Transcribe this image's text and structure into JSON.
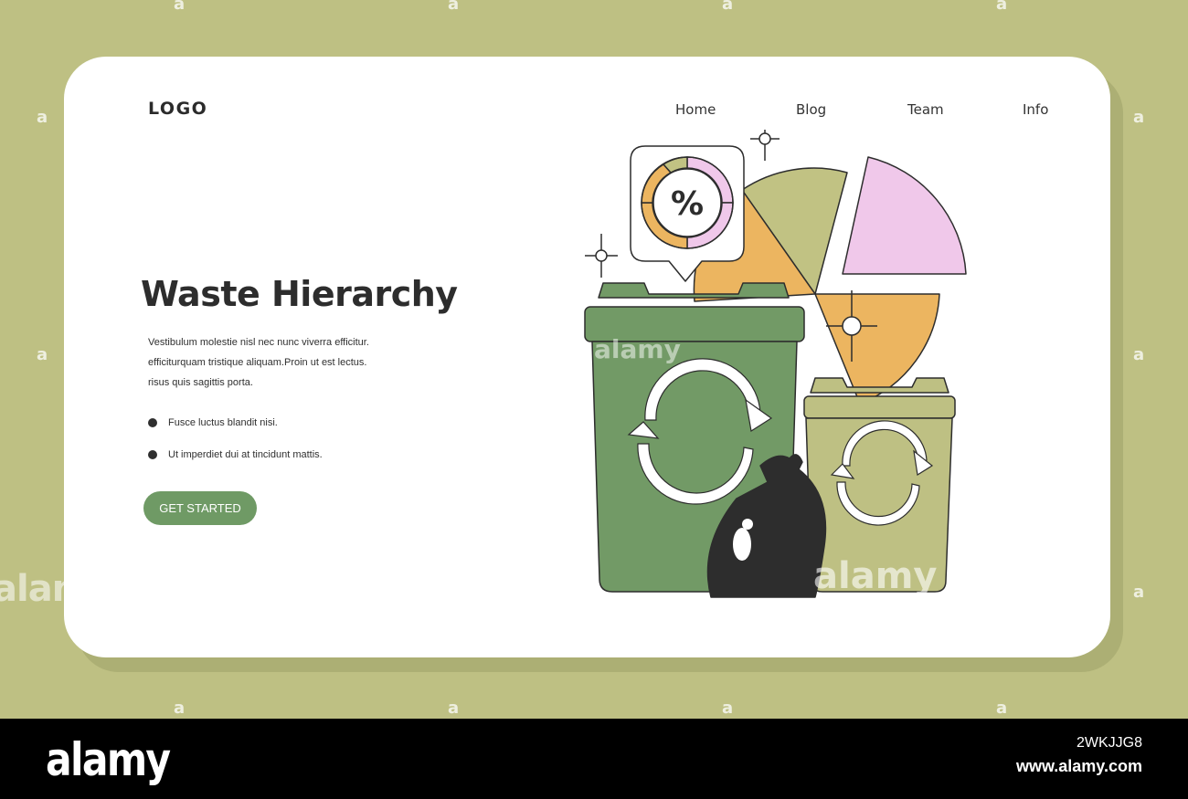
{
  "header": {
    "logo": "LOGO",
    "nav": [
      "Home",
      "Blog",
      "Team",
      "Info"
    ]
  },
  "hero": {
    "title": "Waste Hierarchy",
    "description": [
      "Vestibulum molestie nisl nec nunc viverra efficitur.",
      "efficiturquam tristique aliquam.Proin ut est lectus.",
      "risus quis sagittis porta."
    ],
    "bullets": [
      "Fusce luctus blandit nisi.",
      "Ut imperdiet dui at tincidunt mattis."
    ],
    "cta_label": "GET STARTED"
  },
  "illustration": {
    "badge_symbol": "%",
    "icons": [
      "recycle-icon",
      "garbage-bag-icon",
      "pie-chart-icon",
      "sparkle-icon"
    ]
  },
  "watermark": {
    "brand": "alamy",
    "small": "a",
    "image_id": "2WKJJG8",
    "url": "www.alamy.com"
  },
  "colors": {
    "background": "#bec083",
    "card": "#ffffff",
    "bin_large": "#729a66",
    "bin_small": "#bec083",
    "pie_green": "#c1c283",
    "pie_orange": "#ecb560",
    "pie_pink": "#f0c8ea",
    "button": "#6f9a65",
    "outline": "#2d2d2d"
  }
}
